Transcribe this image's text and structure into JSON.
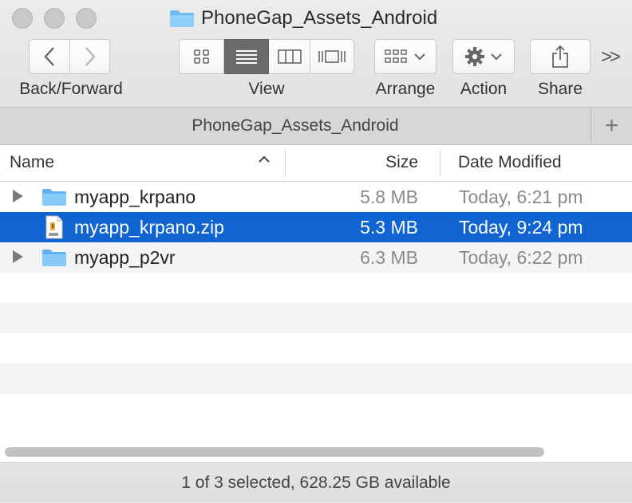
{
  "window": {
    "title": "PhoneGap_Assets_Android",
    "tab_title": "PhoneGap_Assets_Android",
    "add_tab_label": "+"
  },
  "toolbar": {
    "back_forward_label": "Back/Forward",
    "view_label": "View",
    "arrange_label": "Arrange",
    "action_label": "Action",
    "share_label": "Share",
    "more_label": ">>",
    "view_modes": [
      "icon-view",
      "list-view",
      "column-view",
      "cover-flow-view"
    ],
    "selected_view": "list-view"
  },
  "columns": {
    "name": "Name",
    "size": "Size",
    "date_modified": "Date Modified"
  },
  "files": [
    {
      "name": "myapp_krpano",
      "size": "5.8 MB",
      "date": "Today, 6:21 pm",
      "kind": "folder"
    },
    {
      "name": "myapp_krpano.zip",
      "size": "5.3 MB",
      "date": "Today, 9:24 pm",
      "kind": "zip",
      "selected": true
    },
    {
      "name": "myapp_p2vr",
      "size": "6.3 MB",
      "date": "Today, 6:22 pm",
      "kind": "folder"
    }
  ],
  "status": {
    "text": "1 of 3 selected, 628.25 GB available"
  },
  "colors": {
    "selection": "#0f64d2",
    "folder": "#5fb3f0"
  }
}
